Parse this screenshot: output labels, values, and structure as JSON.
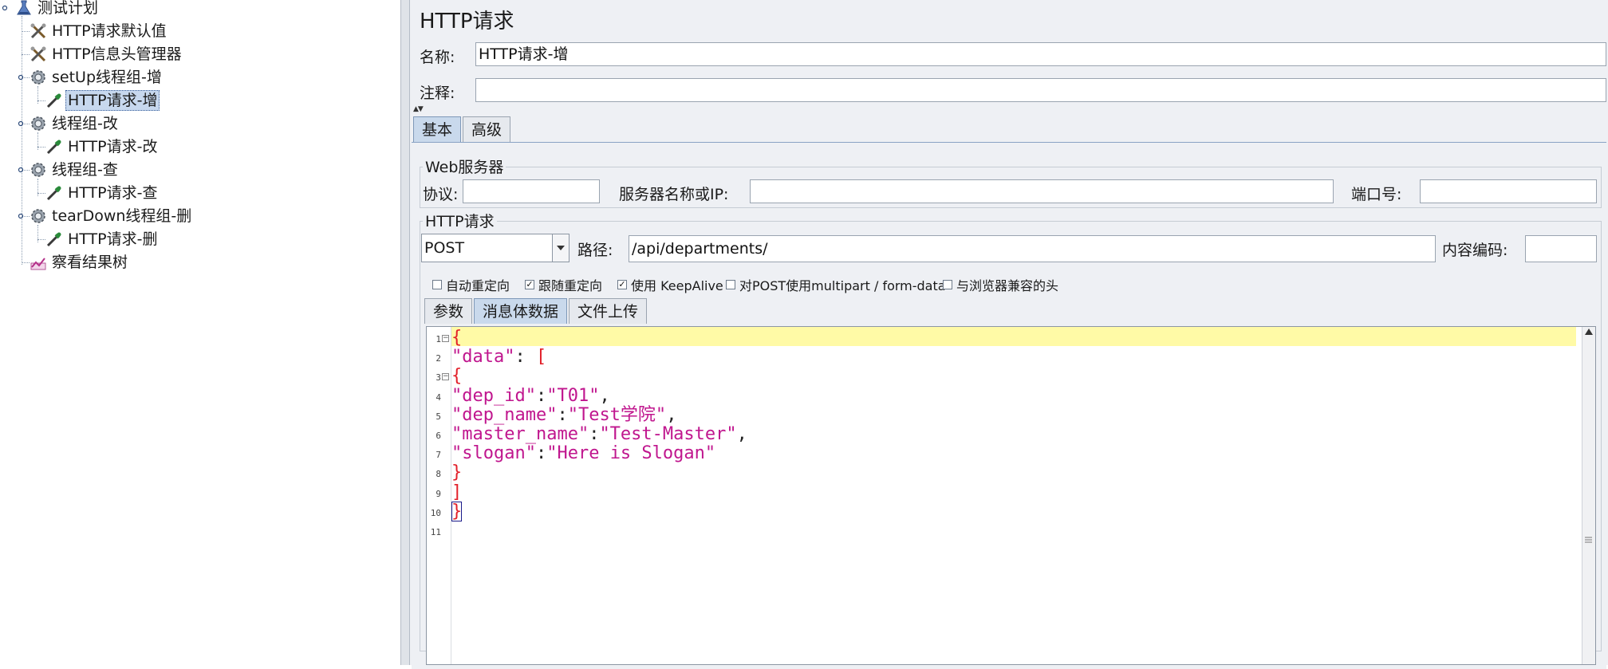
{
  "tree": {
    "items": [
      {
        "label": "测试计划",
        "icon": "test-plan-icon"
      },
      {
        "label": "HTTP请求默认值",
        "icon": "config-tools-icon"
      },
      {
        "label": "HTTP信息头管理器",
        "icon": "config-tools-icon"
      },
      {
        "label": "setUp线程组-增",
        "icon": "gear-icon"
      },
      {
        "label": "HTTP请求-增",
        "icon": "pipette-icon",
        "selected": true
      },
      {
        "label": "线程组-改",
        "icon": "gear-icon"
      },
      {
        "label": "HTTP请求-改",
        "icon": "pipette-icon"
      },
      {
        "label": "线程组-查",
        "icon": "gear-icon"
      },
      {
        "label": "HTTP请求-查",
        "icon": "pipette-icon"
      },
      {
        "label": "tearDown线程组-删",
        "icon": "gear-icon"
      },
      {
        "label": "HTTP请求-删",
        "icon": "pipette-icon"
      },
      {
        "label": "察看结果树",
        "icon": "chart-icon"
      }
    ]
  },
  "panel": {
    "title": "HTTP请求",
    "name_label": "名称:",
    "name_value": "HTTP请求-增",
    "comment_label": "注释:",
    "comment_value": ""
  },
  "tabs": [
    {
      "label": "基本",
      "active": true
    },
    {
      "label": "高级",
      "active": false
    }
  ],
  "web_server": {
    "title": "Web服务器",
    "protocol_label": "协议:",
    "protocol_value": "",
    "server_label": "服务器名称或IP:",
    "server_value": "",
    "port_label": "端口号:",
    "port_value": ""
  },
  "http_request": {
    "title": "HTTP请求",
    "method": "POST",
    "path_label": "路径:",
    "path_value": "/api/departments/",
    "encoding_label": "内容编码:",
    "encoding_value": "",
    "checkboxes": [
      {
        "label": "自动重定向",
        "checked": false
      },
      {
        "label": "跟随重定向",
        "checked": true
      },
      {
        "label": "使用 KeepAlive",
        "checked": true
      },
      {
        "label": "对POST使用multipart / form-data",
        "checked": false
      },
      {
        "label": "与浏览器兼容的头",
        "checked": false
      }
    ]
  },
  "body_tabs": [
    {
      "label": "参数",
      "active": false
    },
    {
      "label": "消息体数据",
      "active": true
    },
    {
      "label": "文件上传",
      "active": false
    }
  ],
  "editor": {
    "line_numbers": [
      "1",
      "2",
      "3",
      "4",
      "5",
      "6",
      "7",
      "8",
      "9",
      "10",
      "11"
    ],
    "lines": [
      [
        {
          "t": "brk",
          "v": "{"
        }
      ],
      [
        {
          "t": "key",
          "v": "\"data\""
        },
        {
          "t": "punc",
          "v": ": "
        },
        {
          "t": "brk",
          "v": "["
        }
      ],
      [
        {
          "t": "brk",
          "v": "{"
        }
      ],
      [
        {
          "t": "key",
          "v": "\"dep_id\""
        },
        {
          "t": "punc",
          "v": ":"
        },
        {
          "t": "str",
          "v": "\"T01\""
        },
        {
          "t": "punc",
          "v": ","
        }
      ],
      [
        {
          "t": "key",
          "v": "\"dep_name\""
        },
        {
          "t": "punc",
          "v": ":"
        },
        {
          "t": "str",
          "v": "\"Test学院\""
        },
        {
          "t": "punc",
          "v": ","
        }
      ],
      [
        {
          "t": "key",
          "v": "\"master_name\""
        },
        {
          "t": "punc",
          "v": ":"
        },
        {
          "t": "str",
          "v": "\"Test-Master\""
        },
        {
          "t": "punc",
          "v": ","
        }
      ],
      [
        {
          "t": "key",
          "v": "\"slogan\""
        },
        {
          "t": "punc",
          "v": ":"
        },
        {
          "t": "str",
          "v": "\"Here is Slogan\""
        }
      ],
      [
        {
          "t": "brk",
          "v": "}"
        }
      ],
      [
        {
          "t": "brk",
          "v": "]"
        }
      ],
      [
        {
          "t": "brk",
          "v": "}",
          "match": true
        }
      ],
      []
    ]
  },
  "colors": {
    "selection": "#c7d8ee",
    "current_line": "#fffaa6",
    "json_key": "#c0168e",
    "json_bracket": "#e2202a"
  }
}
